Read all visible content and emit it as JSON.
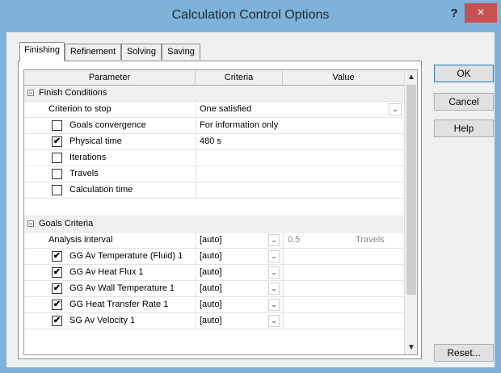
{
  "window": {
    "title": "Calculation Control Options",
    "help_glyph": "?",
    "close_glyph": "×"
  },
  "tabs": [
    {
      "label": "Finishing",
      "active": true
    },
    {
      "label": "Refinement",
      "active": false
    },
    {
      "label": "Solving",
      "active": false
    },
    {
      "label": "Saving",
      "active": false
    }
  ],
  "grid": {
    "headers": {
      "parameter": "Parameter",
      "criteria": "Criteria",
      "value": "Value"
    },
    "finish_conditions": {
      "label": "Finish Conditions",
      "expander": "−",
      "criterion_to_stop": {
        "label": "Criterion to stop",
        "value": "One satisfied"
      },
      "goals_convergence": {
        "label": "Goals convergence",
        "checked": false,
        "criteria": "For information only"
      },
      "physical_time": {
        "label": "Physical time",
        "checked": true,
        "criteria": "480 s"
      },
      "iterations": {
        "label": "Iterations",
        "checked": false
      },
      "travels": {
        "label": "Travels",
        "checked": false
      },
      "calculation_time": {
        "label": "Calculation time",
        "checked": false
      }
    },
    "goals_criteria": {
      "label": "Goals Criteria",
      "expander": "−",
      "analysis_interval": {
        "label": "Analysis interval",
        "criteria": "[auto]",
        "value": "0.5",
        "unit": "Travels"
      },
      "goals": [
        {
          "label": "GG Av Temperature (Fluid) 1",
          "checked": true,
          "criteria": "[auto]"
        },
        {
          "label": "GG Av Heat Flux 1",
          "checked": true,
          "criteria": "[auto]"
        },
        {
          "label": "GG Av Wall Temperature 1",
          "checked": true,
          "criteria": "[auto]"
        },
        {
          "label": "GG Heat Transfer Rate 1",
          "checked": true,
          "criteria": "[auto]"
        },
        {
          "label": "SG Av Velocity 1",
          "checked": true,
          "criteria": "[auto]"
        }
      ]
    },
    "check_glyph": "✔",
    "dropdown_glyph": "⌄"
  },
  "buttons": {
    "ok": "OK",
    "cancel": "Cancel",
    "help": "Help",
    "reset": "Reset..."
  },
  "colors": {
    "titlebar": "#7fb2d9",
    "close": "#c75050"
  }
}
